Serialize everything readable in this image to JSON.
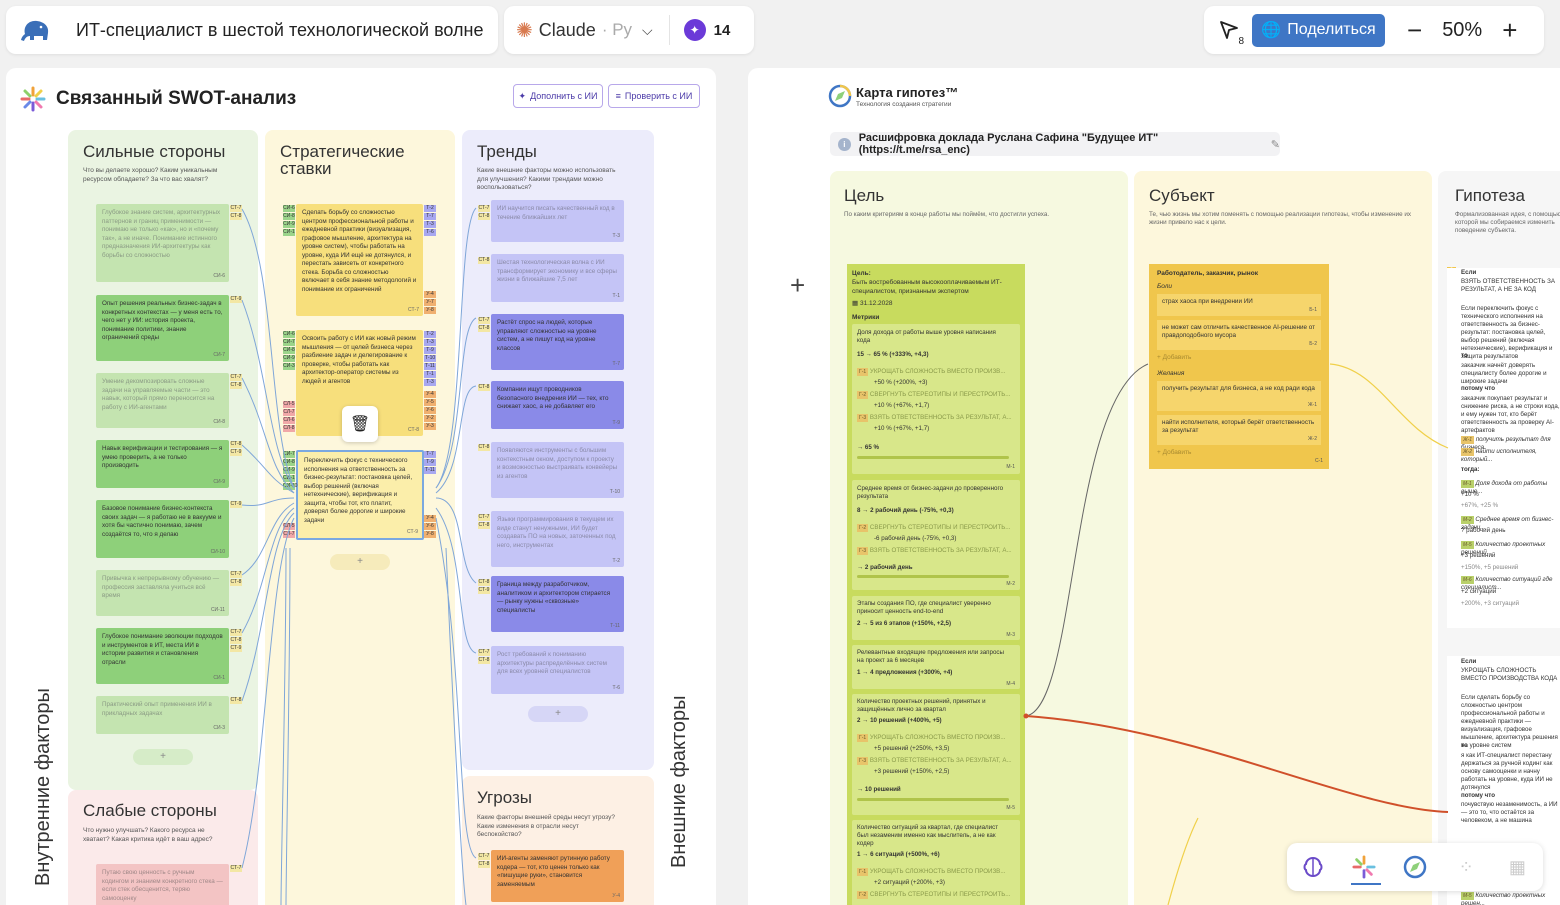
{
  "topbar": {
    "title": "ИТ-специалист в шестой технологической волне",
    "model_name": "Claude",
    "model_lang": "· Ру",
    "credits": "14",
    "cursor_count": "8",
    "share_label": "Поделиться",
    "zoom": "50%"
  },
  "swot": {
    "title": "Связанный SWOT-анализ",
    "btn_augment": "Дополнить с ИИ",
    "btn_check": "Проверить с ИИ",
    "label_internal": "Внутренние факторы",
    "label_external": "Внешние факторы",
    "strengths": {
      "title": "Сильные стороны",
      "sub": "Что вы делаете хорошо? Каким уникальным ресурсом обладаете? За что вас хвалят?",
      "cards": [
        {
          "text": "Глубокое знание систем, архитектурных паттернов и границ применимости — понимаю не только «как», но и «почему так», а не иначе. Понимание истинного предназначения ИИ-архитектуры как борьбы со сложностью",
          "id": "СИ-6"
        },
        {
          "text": "Опыт решения реальных бизнес-задач в конкретных контекстах — у меня есть то, чего нет у ИИ: история проекта, понимание политики, знание ограничений среды",
          "id": "СИ-7"
        },
        {
          "text": "Умение декомпозировать сложные задачи на управляемые части — это навык, который прямо переносится на работу с ИИ-агентами",
          "id": "СИ-8"
        },
        {
          "text": "Навык верификации и тестирования — я умею проверить, а не только производить",
          "id": "СИ-9"
        },
        {
          "text": "Базовое понимание бизнес-контекста своих задач — я работаю не в вакууме и хотя бы частично понимаю, зачем создаётся то, что я делаю",
          "id": "СИ-10"
        },
        {
          "text": "Привычка к непрерывному обучению — профессия заставляла учиться всё время",
          "id": "СИ-11"
        },
        {
          "text": "Глубокое понимание эволюции подходов и инструментов в ИТ, места ИИ в истории развития и становления отрасли",
          "id": "СИ-1"
        },
        {
          "text": "Практический опыт применения ИИ в прикладных задачах",
          "id": "СИ-3"
        }
      ],
      "tags": [
        "СТ-7",
        "СТ-8",
        "СТ-9",
        "СТ-7",
        "СТ-8",
        "СТ-8",
        "СТ-9",
        "СТ-9",
        "СТ-7",
        "СТ-8",
        "СТ-7",
        "СТ-8",
        "СТ-9",
        "СТ-8"
      ]
    },
    "weaknesses": {
      "title": "Слабые стороны",
      "sub": "Что нужно улучшать? Какого ресурса не хватает? Какая критика идёт в ваш адрес?",
      "card": "Путаю свою ценность с ручным кодингом и знанием конкретного стека — если стек обесценится, теряю самооценку",
      "tag": "СТ-7"
    },
    "bets": {
      "title": "Стратегические ставки",
      "cards": [
        {
          "text": "Сделать борьбу со сложностью центром профессиональной работы и ежедневной практики (визуализация, графовое мышление, архитектура на уровне систем), чтобы работать на уровне, куда ИИ ещё не дотянулся, и перестать зависеть от конкретного стека. Борьба со сложностью включает в себя знание методологий и понимание их ограничений",
          "id": "СТ-7"
        },
        {
          "text": "Освоить работу с ИИ как новый режим мышления — от целей бизнеса через разбиение задач и делегирование к проверке, чтобы работать как архитектор-оператор системы из людей и агентов",
          "id": "СТ-8"
        },
        {
          "text": "Переключить фокус с технического исполнения на ответственность за бизнес-результат: постановка целей, выбор решений (включая нетехнические), верификация и защита, чтобы тот, кто платит, доверял более дорогие и широкие задачи",
          "id": "СТ-9"
        }
      ],
      "left_tags": [
        "СИ-6",
        "СИ-8",
        "СИ-9",
        "СИ-1",
        "СИ-6",
        "СИ-7",
        "СИ-8",
        "СИ-9",
        "СИ-3",
        "СЛ-5",
        "СЛ-7",
        "СЛ-6",
        "СЛ-8",
        "СИ-7",
        "СИ-8",
        "СИ-9",
        "СИ-1",
        "СИ-10",
        "СЛ-5",
        "СЛ-7"
      ],
      "right_tags": [
        "Т-2",
        "Т-7",
        "Т-3",
        "Т-6",
        "У-4",
        "У-7",
        "У-8",
        "Т-2",
        "Т-3",
        "Т-9",
        "Т-10",
        "Т-11",
        "Т-1",
        "Т-3",
        "У-4",
        "У-5",
        "У-6",
        "У-2",
        "У-3",
        "Т-7",
        "Т-9",
        "Т-11",
        "У-4",
        "У-6",
        "У-8"
      ]
    },
    "trends": {
      "title": "Тренды",
      "sub": "Какие внешние факторы можно использовать для улучшения? Какими трендами можно воспользоваться?",
      "cards": [
        {
          "text": "ИИ научится писать качественный код в течение ближайших лет",
          "id": "Т-3"
        },
        {
          "text": "Шестая технологическая волна с ИИ трансформирует экономику и все сферы жизни в ближайшие 7,5 лет",
          "id": "Т-1"
        },
        {
          "text": "Растёт спрос на людей, которые управляют сложностью на уровне систем, а не пишут код на уровне классов",
          "id": "Т-7"
        },
        {
          "text": "Компании ищут проводников безопасного внедрения ИИ — тех, кто снижает хаос, а не добавляет его",
          "id": "Т-9"
        },
        {
          "text": "Появляются инструменты с большим контекстным окном, доступом к проекту и возможностью выстраивать конвейеры из агентов",
          "id": "Т-10"
        },
        {
          "text": "Языки программирования в текущем их виде станут ненужными, ИИ будет создавать ПО на новых, заточенных под него, инструментах",
          "id": "Т-2"
        },
        {
          "text": "Граница между разработчиком, аналитиком и архитектором стирается — рынку нужны «сквозные» специалисты",
          "id": "Т-11"
        },
        {
          "text": "Рост требований к пониманию архитектуры распределённых систем для всех уровней специалистов",
          "id": "Т-6"
        }
      ],
      "tags": [
        "СТ-7",
        "СТ-8",
        "СТ-8",
        "СТ-7",
        "СТ-8",
        "СТ-8",
        "СТ-8",
        "СТ-7",
        "СТ-8",
        "СТ-8",
        "СТ-9",
        "СТ-7",
        "СТ-8"
      ]
    },
    "threats": {
      "title": "Угрозы",
      "sub": "Какие факторы внешней среды несут угрозу? Какие изменения в отрасли несут беспокойство?",
      "card": "ИИ-агенты заменяют рутинную работу кодера — тот, кто ценен только как «пишущие руки», становится заменяемым",
      "id": "У-4",
      "tags": [
        "СТ-7",
        "СТ-8"
      ]
    }
  },
  "hypothesis_map": {
    "title": "Карта гипотез™",
    "subtitle": "Технология создания стратегии",
    "source": "Расшифровка доклада Руслана Сафина \"Будущее ИТ\" (https://t.me/rsa_enc)",
    "goal": {
      "title": "Цель",
      "sub": "По каким критериям в конце работы мы поймём, что достигли успеха.",
      "card_label": "Цель:",
      "card_text": "Быть востребованным высокооплачиваемым ИТ-специалистом, признанным экспертом",
      "date": "31.12.2028",
      "metrics_label": "Метрики",
      "metrics": [
        {
          "name": "Доля дохода от работы выше уровня написания кода",
          "value": "15 → 65 % (+333%, +4,3)",
          "links": [
            {
              "tag": "Г-1",
              "text": "УКРОЩАТЬ СЛОЖНОСТЬ ВМЕСТО ПРОИЗВ...",
              "val": "+50 % (+200%, +3)"
            },
            {
              "tag": "Г-2",
              "text": "СВЕРГНУТЬ СТЕРЕОТИПЫ И ПЕРЕСТРОИТЬ...",
              "val": "+10 % (+67%, +1,7)"
            },
            {
              "tag": "Г-3",
              "text": "ВЗЯТЬ ОТВЕТСТВЕННОСТЬ ЗА РЕЗУЛЬТАТ, А...",
              "val": "+10 % (+67%, +1,7)"
            }
          ],
          "target": "→ 65 %",
          "id": "М-1"
        },
        {
          "name": "Среднее время от бизнес-задачи до проверенного результата",
          "value": "8 → 2 рабочий день (-75%, +0,3)",
          "links": [
            {
              "tag": "Г-2",
              "text": "СВЕРГНУТЬ СТЕРЕОТИПЫ И ПЕРЕСТРОИТЬ...",
              "val": "-6 рабочий день (-75%, +0,3)"
            },
            {
              "tag": "Г-3",
              "text": "ВЗЯТЬ ОТВЕТСТВЕННОСТЬ ЗА РЕЗУЛЬТАТ, А...",
              "val": ""
            }
          ],
          "target": "→ 2 рабочий день",
          "id": "М-2"
        },
        {
          "name": "Этапы создания ПО, где специалист уверенно приносит ценность end-to-end",
          "value": "2 → 5 из 6 этапов (+150%, +2,5)",
          "links": [],
          "target": "",
          "id": "М-3"
        },
        {
          "name": "Релевантные входящие предложения или запросы на проект за 6 месяцев",
          "value": "1 → 4 предложения (+300%, +4)",
          "links": [],
          "target": "",
          "id": "М-4"
        },
        {
          "name": "Количество проектных решений, принятых и защищённых лично за квартал",
          "value": "2 → 10 решений (+400%, +5)",
          "links": [
            {
              "tag": "Г-1",
              "text": "УКРОЩАТЬ СЛОЖНОСТЬ ВМЕСТО ПРОИЗВ...",
              "val": "+5 решений (+250%, +3,5)"
            },
            {
              "tag": "Г-3",
              "text": "ВЗЯТЬ ОТВЕТСТВЕННОСТЬ ЗА РЕЗУЛЬТАТ, А...",
              "val": "+3 решений (+150%, +2,5)"
            }
          ],
          "target": "→ 10 решений",
          "id": "М-5"
        },
        {
          "name": "Количество ситуаций за квартал, где специалист был незаменим именно как мыслитель, а не как кодер",
          "value": "1 → 6 ситуаций (+500%, +6)",
          "links": [
            {
              "tag": "Г-1",
              "text": "УКРОЩАТЬ СЛОЖНОСТЬ ВМЕСТО ПРОИЗВ...",
              "val": "+2 ситуаций (+200%, +3)"
            },
            {
              "tag": "Г-2",
              "text": "СВЕРГНУТЬ СТЕРЕОТИПЫ И ПЕРЕСТРОИТЬ...",
              "val": ""
            }
          ],
          "target": "",
          "id": "М-6"
        }
      ]
    },
    "subject": {
      "title": "Субъект",
      "sub": "Те, чью жизнь мы хотим поменять с помощью реализации гипотезы, чтобы изменение их жизни привело нас к цели.",
      "card_title": "Работодатель, заказчик, рынок",
      "pains_label": "Боли",
      "pains": [
        {
          "text": "страх хаоса при внедрении ИИ",
          "id": "Б-1"
        },
        {
          "text": "не может сам отличить качественное AI-решение от правдоподобного мусора",
          "id": "Б-2"
        }
      ],
      "add1": "+ Добавить",
      "wishes_label": "Желания",
      "wishes": [
        {
          "text": "получить результат для бизнеса, а не код ради кода",
          "id": "Ж-1"
        },
        {
          "text": "найти исполнителя, который берёт ответственность за результат",
          "id": "Ж-2"
        }
      ],
      "add2": "+ Добавить",
      "card_id": "С-1"
    },
    "hypothesis": {
      "title": "Гипотеза",
      "sub": "Формализованная идея, с помощью которой мы собираемся изменить поведение субъекта.",
      "h2": {
        "num": "2",
        "if_label": "Если",
        "if_title": "ВЗЯТЬ ОТВЕТСТВЕННОСТЬ ЗА РЕЗУЛЬТАТ, А НЕ ЗА КОД",
        "if_text": "Если переключить фокус с технического исполнения на ответственность за бизнес-результат: постановка целей, выбор решений (включая нетехнические), верификация и защита результатов",
        "then_label": "то",
        "then_text": "заказчик начнёт доверять специалисту более дорогие и широкие задачи",
        "because_label": "потому что",
        "because_text": "заказчик покупает результат и снижение риска, а не строки кода, и ему нужен тот, кто берёт ответственность за проверку AI-артефактов",
        "links": [
          {
            "tag": "Ж-1",
            "text": "получить результат для бизнеса"
          },
          {
            "tag": "Ж-2",
            "text": "найти исполнителя, который..."
          }
        ],
        "then2_label": "тогда:",
        "metrics": [
          {
            "tag": "М-1",
            "text": "Доля дохода от работы выше...",
            "val": "+10 %",
            "pct": "+67%, +25 %"
          },
          {
            "tag": "М-2",
            "text": "Среднее время от бизнес-задачи...",
            "val": "? рабочий день",
            "pct": ""
          },
          {
            "tag": "М-5",
            "text": "Количество проектных решений...",
            "val": "+3 решений",
            "pct": "+150%, +5 решений"
          },
          {
            "tag": "М-6",
            "text": "Количество ситуаций где специалист...",
            "val": "+2 ситуаций",
            "pct": "+200%, +3 ситуаций"
          }
        ]
      },
      "h1": {
        "num": "1",
        "if_label": "Если",
        "if_title": "УКРОЩАТЬ СЛОЖНОСТЬ ВМЕСТО ПРОИЗВОДСТВА КОДА",
        "if_text": "Если сделать борьбу со сложностью центром профессиональной работы и ежедневной практики — визуализация, графовое мышление, архитектура решения на уровне систем",
        "then_label": "то",
        "then_text": "я как ИТ-специалист перестану держаться за ручной кодинг как основу самооценки и начну работать на уровне, куда ИИ не дотянулся",
        "because_label": "потому что",
        "because_text": "почувствую незаменимость, а ИИ — это то, что остаётся за человеком, а не машина",
        "last_tag": "М-5",
        "last_text": "Количество проектных решен..."
      }
    }
  },
  "dock": {
    "items": [
      "brain-icon",
      "swot-icon",
      "compass-icon",
      "grid-icon",
      "layout-icon"
    ]
  }
}
